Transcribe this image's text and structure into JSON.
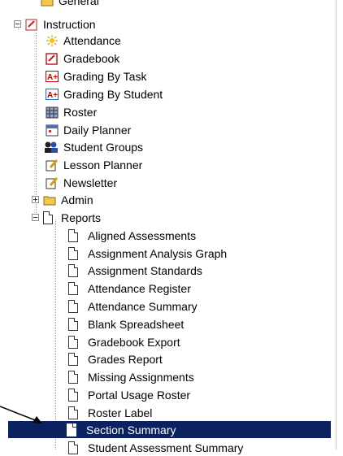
{
  "tree": {
    "general": "General",
    "instruction": "Instruction",
    "instruction_items": [
      "Attendance",
      "Gradebook",
      "Grading By Task",
      "Grading By Student",
      "Roster",
      "Daily Planner",
      "Student Groups",
      "Lesson Planner",
      "Newsletter"
    ],
    "admin": "Admin",
    "reports": "Reports",
    "report_items": [
      "Aligned Assessments",
      "Assignment Analysis Graph",
      "Assignment Standards",
      "Attendance Register",
      "Attendance Summary",
      "Blank Spreadsheet",
      "Gradebook Export",
      "Grades Report",
      "Missing Assignments",
      "Portal Usage Roster",
      "Roster Label",
      "Section Summary",
      "Student Assessment Summary"
    ],
    "selected": "Section Summary"
  }
}
